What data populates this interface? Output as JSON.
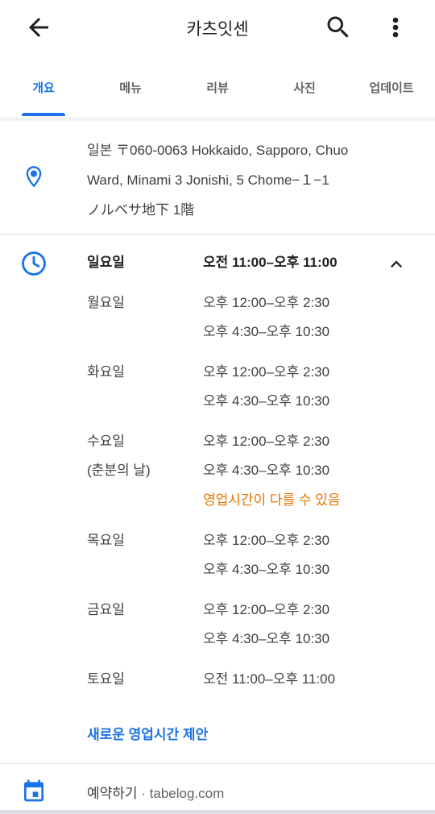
{
  "header": {
    "title": "카츠잇센"
  },
  "tabs": [
    {
      "label": "개요",
      "active": true
    },
    {
      "label": "메뉴",
      "active": false
    },
    {
      "label": "리뷰",
      "active": false
    },
    {
      "label": "사진",
      "active": false
    },
    {
      "label": "업데이트",
      "active": false
    }
  ],
  "address": {
    "line1": "일본 〒060-0063 Hokkaido, Sapporo, Chuo",
    "line2": "Ward, Minami 3 Jonishi, 5 Chome−１−1",
    "line3": "ノルベサ地下 1階"
  },
  "hours": {
    "today": {
      "day": "일요일",
      "hours": "오전 11:00–오후 11:00"
    },
    "days": [
      {
        "day": "월요일",
        "hours": [
          "오후 12:00–오후 2:30",
          "오후 4:30–오후 10:30"
        ]
      },
      {
        "day": "화요일",
        "hours": [
          "오후 12:00–오후 2:30",
          "오후 4:30–오후 10:30"
        ]
      },
      {
        "day": "수요일",
        "note": "(춘분의 날)",
        "hours": [
          "오후 12:00–오후 2:30",
          "오후 4:30–오후 10:30"
        ],
        "warning": "영업시간이 다를 수 있음"
      },
      {
        "day": "목요일",
        "hours": [
          "오후 12:00–오후 2:30",
          "오후 4:30–오후 10:30"
        ]
      },
      {
        "day": "금요일",
        "hours": [
          "오후 12:00–오후 2:30",
          "오후 4:30–오후 10:30"
        ]
      },
      {
        "day": "토요일",
        "hours": [
          "오전 11:00–오후 11:00"
        ]
      }
    ],
    "suggest_link": "새로운 영업시간 제안"
  },
  "reservation": {
    "label": "예약하기",
    "separator": " · ",
    "source": "tabelog.com"
  },
  "colors": {
    "accent": "#1a73e8",
    "warning": "#e37400",
    "text": "#3c4043"
  }
}
